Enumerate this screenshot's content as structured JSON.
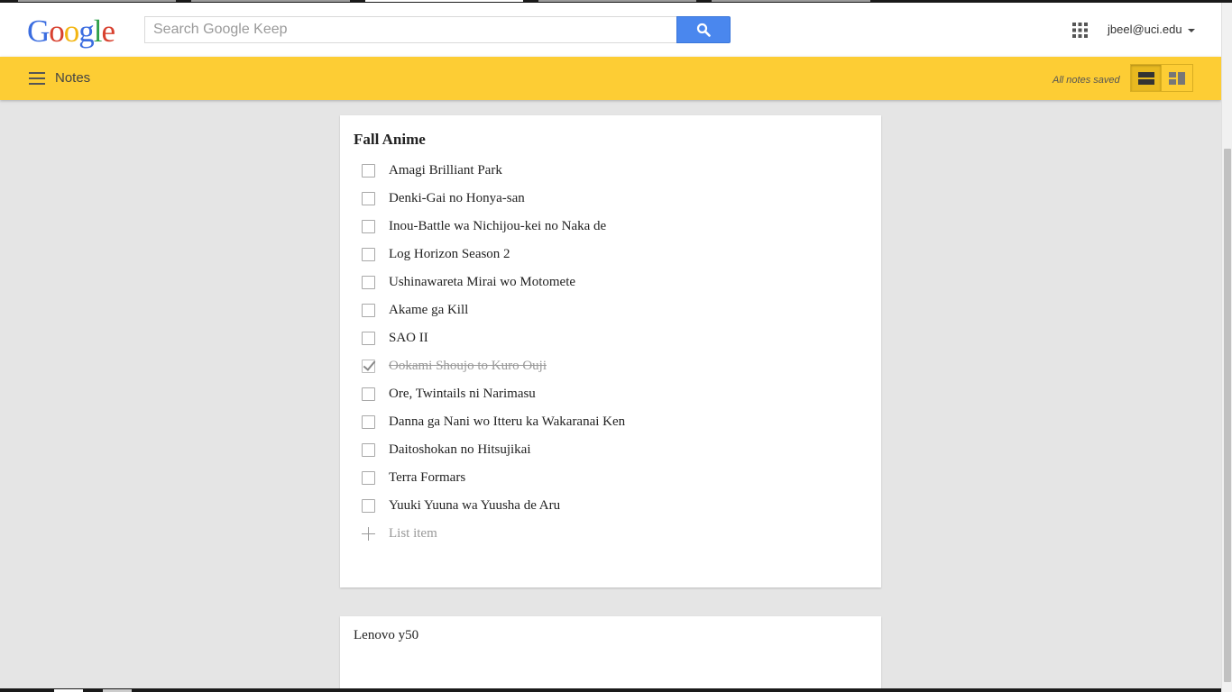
{
  "header": {
    "logo_letters": [
      "G",
      "o",
      "o",
      "g",
      "l",
      "e"
    ],
    "search_placeholder": "Search Google Keep",
    "account": "jbeel@uci.edu"
  },
  "bar": {
    "title": "Notes",
    "status": "All notes saved",
    "view_mode": "list",
    "color": "#fdcd34"
  },
  "notes": [
    {
      "title": "Fall Anime",
      "items": [
        {
          "text": "Amagi Brilliant Park",
          "checked": false
        },
        {
          "text": "Denki-Gai no Honya-san",
          "checked": false
        },
        {
          "text": "Inou-Battle wa Nichijou-kei no Naka de",
          "checked": false
        },
        {
          "text": "Log Horizon Season 2",
          "checked": false
        },
        {
          "text": "Ushinawareta Mirai wo Motomete",
          "checked": false
        },
        {
          "text": "Akame ga Kill",
          "checked": false
        },
        {
          "text": "SAO II",
          "checked": false
        },
        {
          "text": "Ookami Shoujo to Kuro Ouji",
          "checked": true
        },
        {
          "text": "Ore, Twintails ni Narimasu",
          "checked": false
        },
        {
          "text": "Danna ga Nani wo Itteru ka Wakaranai Ken",
          "checked": false
        },
        {
          "text": "Daitoshokan no Hitsujikai",
          "checked": false
        },
        {
          "text": "Terra Formars",
          "checked": false
        },
        {
          "text": "Yuuki Yuuna wa Yuusha de Aru",
          "checked": false
        }
      ],
      "add_placeholder": "List item"
    },
    {
      "title": "Lenovo y50"
    }
  ]
}
